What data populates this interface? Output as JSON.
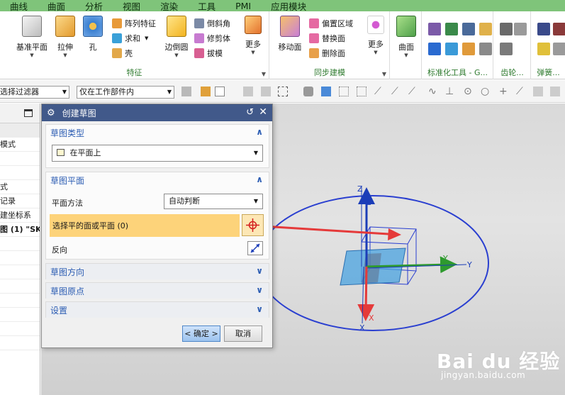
{
  "menu": [
    "曲线",
    "曲面",
    "分析",
    "视图",
    "渲染",
    "工具",
    "PMI",
    "应用模块"
  ],
  "ribbon": {
    "feature_group": {
      "label": "特征",
      "big_buttons": [
        {
          "label": "基准平面"
        },
        {
          "label": "拉伸"
        },
        {
          "label": "孔"
        },
        {
          "label": "边倒圆"
        }
      ],
      "small_col1": [
        "阵列特征",
        "求和",
        "壳"
      ],
      "small_col2": [
        "倒斜角",
        "修剪体",
        "拔模"
      ],
      "more": "更多"
    },
    "sync_group": {
      "label": "同步建模",
      "big_buttons": [
        {
          "label": "移动面"
        }
      ],
      "small_col": [
        "偏置区域",
        "替换面",
        "删除面"
      ],
      "more": "更多"
    },
    "surface_group": {
      "label": "",
      "big_buttons": [
        {
          "label": "曲面"
        }
      ]
    },
    "std_group": {
      "label": "标准化工具 - G..."
    },
    "gear_group": {
      "label": "齿轮..."
    },
    "spring_group": {
      "label": "弹簧..."
    }
  },
  "toolbar": {
    "filter_combo": "选择过滤器",
    "scope_combo": "仅在工作部件内"
  },
  "navigator": {
    "rows": [
      "",
      "模式",
      "",
      "",
      "式",
      "记录",
      "建坐标系",
      "图 (1) \"SK",
      "",
      "",
      "",
      "",
      "",
      "",
      "",
      ""
    ]
  },
  "dialog": {
    "title": "创建草图",
    "sections": {
      "type": {
        "title": "草图类型",
        "value": "在平面上"
      },
      "plane": {
        "title": "草图平面",
        "method_label": "平面方法",
        "method_value": "自动判断",
        "select_label": "选择平的面或平面 (0)",
        "reverse_label": "反向"
      },
      "direction": {
        "title": "草图方向"
      },
      "origin": {
        "title": "草图原点"
      },
      "settings": {
        "title": "设置"
      }
    },
    "ok": "< 确定 >",
    "cancel": "取消"
  },
  "viewport": {
    "axis_labels": {
      "z_top": "Z",
      "z_inner": "Z",
      "y_inner": "Y",
      "y_outer": "Y",
      "x_inner": "X",
      "x_outer": "X"
    },
    "colors": {
      "ellipse": "#2a3fd0",
      "plane": "#4aa3e0",
      "arrow": "#e53a3a",
      "z_axis": "#1b3db8",
      "y_axis": "#2e9a2e"
    }
  },
  "watermark": {
    "brand": "Bai du 经验",
    "url": "jingyan.baidu.com"
  }
}
